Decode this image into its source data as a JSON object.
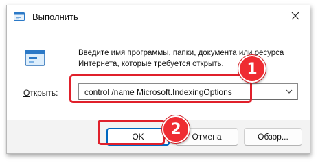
{
  "window": {
    "title": "Выполнить",
    "app_icon": "run-dialog-icon",
    "close_icon": "close-icon"
  },
  "content": {
    "description": "Введите имя программы, папки, документа или ресурса Интернета, которые требуется открыть.",
    "open_label_accel": "О",
    "open_label_rest": "ткрыть:",
    "command_value": "control /name Microsoft.IndexingOptions"
  },
  "buttons": {
    "ok": "OK",
    "cancel": "Отмена",
    "browse": "Обзор..."
  },
  "annotations": {
    "step1": "1",
    "step2": "2",
    "highlight_color": "#e0202b",
    "badge_color": "#ef2c32"
  },
  "colors": {
    "accent": "#0067c0",
    "window_bg": "#f3f3f3"
  }
}
